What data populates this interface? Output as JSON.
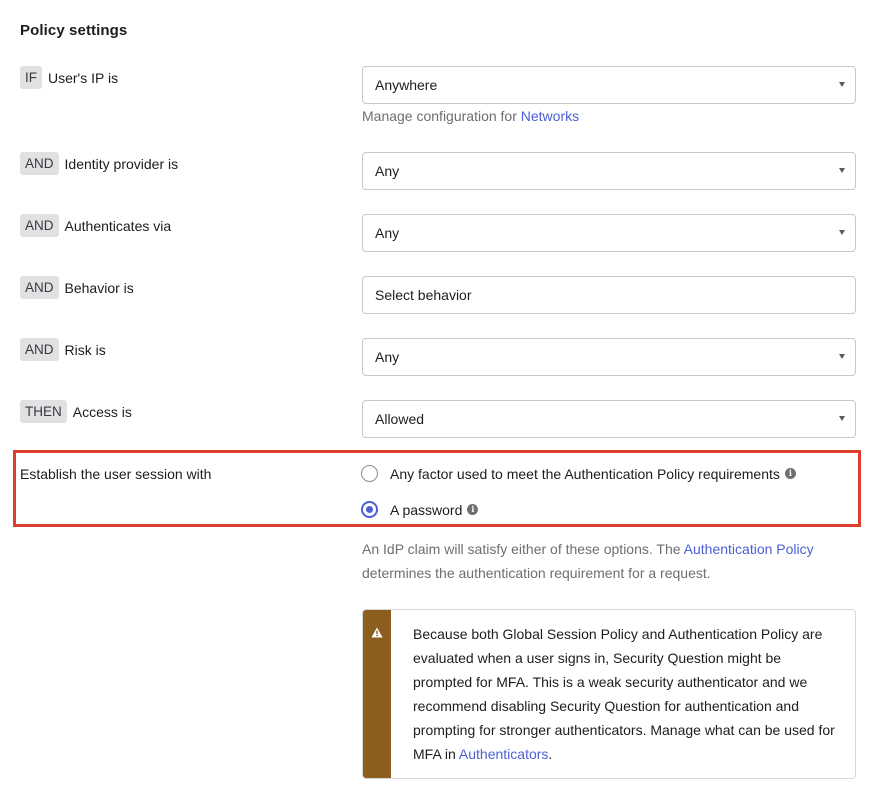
{
  "section": {
    "title": "Policy settings"
  },
  "conditions": [
    {
      "op": "IF",
      "label": "User's IP is",
      "value": "Anywhere",
      "dropdown": true
    },
    {
      "op": "AND",
      "label": "Identity provider is",
      "value": "Any",
      "dropdown": true
    },
    {
      "op": "AND",
      "label": "Authenticates via",
      "value": "Any",
      "dropdown": true
    },
    {
      "op": "AND",
      "label": "Behavior is",
      "value": "Select behavior",
      "dropdown": false
    },
    {
      "op": "AND",
      "label": "Risk is",
      "value": "Any",
      "dropdown": true
    },
    {
      "op": "THEN",
      "label": "Access is",
      "value": "Allowed",
      "dropdown": true
    }
  ],
  "ip_help": {
    "prefix": "Manage configuration for ",
    "link": "Networks"
  },
  "session": {
    "label": "Establish the user session with",
    "options": [
      {
        "label": "Any factor used to meet the Authentication Policy requirements",
        "selected": false
      },
      {
        "label": "A password",
        "selected": true
      }
    ],
    "help_prefix": "An IdP claim will satisfy either of these options. The ",
    "help_link": "Authentication Policy",
    "help_suffix": "determines the authentication requirement for a request."
  },
  "callout": {
    "text": "Because both Global Session Policy and Authentication Policy are evaluated when a user signs in, Security Question might be prompted for MFA. This is a weak security authenticator and we recommend disabling Security Question for authentication and prompting for stronger authenticators. Manage what can be used for MFA in ",
    "link": "Authenticators",
    "end": "."
  },
  "colors": {
    "accent": "#4b5fd6",
    "highlight": "#e03e2d",
    "warning": "#8b5e1e"
  },
  "icons": {
    "dropdown": "chevron-down-icon",
    "info": "info-icon",
    "warning": "warning-icon"
  }
}
